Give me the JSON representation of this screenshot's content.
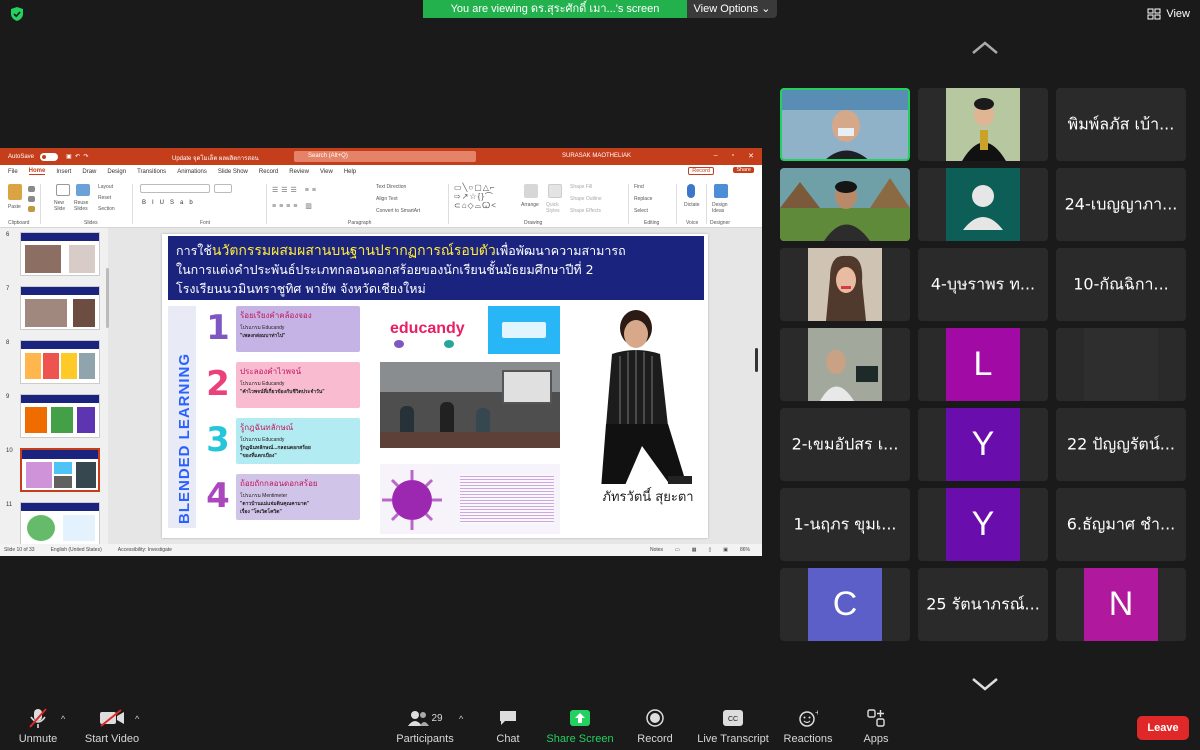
{
  "zoom": {
    "viewing_text": "You are viewing ดร.สุระศักดิ์ เมา...'s screen",
    "view_options_label": "View Options",
    "view_label": "View"
  },
  "ppt": {
    "autosave_label": "AutoSave",
    "toggle_state": "Off",
    "document_title": "Update จุดโมเล็ต  ผลผลิตการสอน",
    "search_placeholder": "Search (Alt+Q)",
    "user_name": "SURASAK MAOTHELIAK",
    "menu": [
      "File",
      "Home",
      "Insert",
      "Draw",
      "Design",
      "Transitions",
      "Animations",
      "Slide Show",
      "Record",
      "Review",
      "View",
      "Help"
    ],
    "record_label": "Record",
    "share_label": "Share",
    "ribbon": {
      "paste": "Paste",
      "new_slide": "New Slide",
      "reuse_slides": "Reuse Slides",
      "layout": "Layout",
      "reset": "Reset",
      "section": "Section",
      "text_direction": "Text Direction",
      "align_text": "Align Text",
      "convert_smartart": "Convert to SmartArt",
      "arrange": "Arrange",
      "quick_styles": "Quick Styles",
      "shape_fill": "Shape Fill",
      "shape_outline": "Shape Outline",
      "shape_effects": "Shape Effects",
      "find": "Find",
      "replace": "Replace",
      "select": "Select",
      "dictate": "Dictate",
      "design_ideas": "Design Ideas",
      "groups": [
        "Clipboard",
        "Slides",
        "Font",
        "Paragraph",
        "Drawing",
        "Editing",
        "Voice",
        "Designer"
      ]
    },
    "thumbnails": [
      {
        "num": "6"
      },
      {
        "num": "7"
      },
      {
        "num": "8"
      },
      {
        "num": "9"
      },
      {
        "num": "10"
      },
      {
        "num": "11"
      }
    ],
    "slide": {
      "head_line1_a": "การใช้",
      "head_line1_b": "นวัตกรรมผสมผสานบนฐานปรากฏการณ์รอบตัว",
      "head_line1_c": "เพื่อพัฒนาความสามารถ",
      "head_line2": "ในการแต่งคำประพันธ์ประเภทกลอนดอกสร้อยของนักเรียนชั้นมัธยมศึกษาปีที่  2",
      "head_line3": "โรงเรียนนวมินทราชูทิศ  พายัพ  จังหวัดเชียงใหม่",
      "side_label": "BLENDED LEARNING",
      "steps": [
        {
          "num": "1",
          "title": "ร้อยเรียงคำคล้องจอง",
          "line1": "โปรแกรม Educandy",
          "line2": "\"เพลงกล่อมบาท่าไป\""
        },
        {
          "num": "2",
          "title": "ประลองคำไวพจน์",
          "line1": "โปรแกรม Educandy",
          "line2": "\"คำไวพจน์ที่เกี่ยวข้องกับชีวิตประจำวัน\""
        },
        {
          "num": "3",
          "title": "รู้กฎฉันทลักษณ์",
          "line1": "โปรแกรม Educandy",
          "line2": "รู้กฎฉันทลักษณ์...กลอนดอกสร้อย"
        },
        {
          "num": "4",
          "title": "ถ้อยถักกลอนดอกสร้อย",
          "line1": "โปรแกรม Mentimeter",
          "line2": "\"ดาวบ้านแม่แจ่มดินคุณคามาด\""
        }
      ],
      "step3_line3": "\"ของที่แตกเบือง\"",
      "step4_line3": "เรื่อง \"โคเวิดโควิด\"",
      "logo_text": "educandy",
      "name_card": "ภัทรวัตนี์  สุยะตา"
    },
    "status": {
      "slide_count": "Slide 10 of 33",
      "language": "English (United States)",
      "accessibility": "Accessibility: Investigate",
      "notes": "Notes",
      "zoom": "86%"
    }
  },
  "participants": [
    {
      "name": "",
      "type": "video",
      "active": true
    },
    {
      "name": "",
      "type": "video"
    },
    {
      "name": "พิมพ์ลภัส เบ้า...",
      "type": "name"
    },
    {
      "name": "",
      "type": "video"
    },
    {
      "name": "",
      "type": "avatar"
    },
    {
      "name": "24-เบญญาภา...",
      "type": "name"
    },
    {
      "name": "",
      "type": "video"
    },
    {
      "name": "4-บุษราพร ท...",
      "type": "name"
    },
    {
      "name": "10-กัณฉิกา...",
      "type": "name"
    },
    {
      "name": "",
      "type": "video"
    },
    {
      "name": "L",
      "type": "initial",
      "color": "#a20aa6"
    },
    {
      "name": "",
      "type": "blank"
    },
    {
      "name": "2-เขมอัปสร เ...",
      "type": "name"
    },
    {
      "name": "Y",
      "type": "initial",
      "color": "#6a0dad"
    },
    {
      "name": "22 ปัญญรัตน์...",
      "type": "name"
    },
    {
      "name": "1-นฤภร ขุมเ...",
      "type": "name"
    },
    {
      "name": "Y",
      "type": "initial",
      "color": "#6a0dad"
    },
    {
      "name": "6.ธัญมาศ ชำ...",
      "type": "name"
    },
    {
      "name": "C",
      "type": "initial",
      "color": "#5b5fc7"
    },
    {
      "name": "25 รัตนาภรณ์...",
      "type": "name"
    },
    {
      "name": "N",
      "type": "initial",
      "color": "#b0189d"
    }
  ],
  "toolbar": {
    "unmute": "Unmute",
    "start_video": "Start Video",
    "participants_count": "29",
    "participants": "Participants",
    "chat": "Chat",
    "share_screen": "Share Screen",
    "record": "Record",
    "live_transcript": "Live Transcript",
    "reactions": "Reactions",
    "apps": "Apps",
    "leave": "Leave"
  },
  "colors": {
    "zoom_green": "#23b14d",
    "ppt_red": "#c43e1c",
    "leave_red": "#e02828",
    "slide_navy": "#1a237e"
  }
}
